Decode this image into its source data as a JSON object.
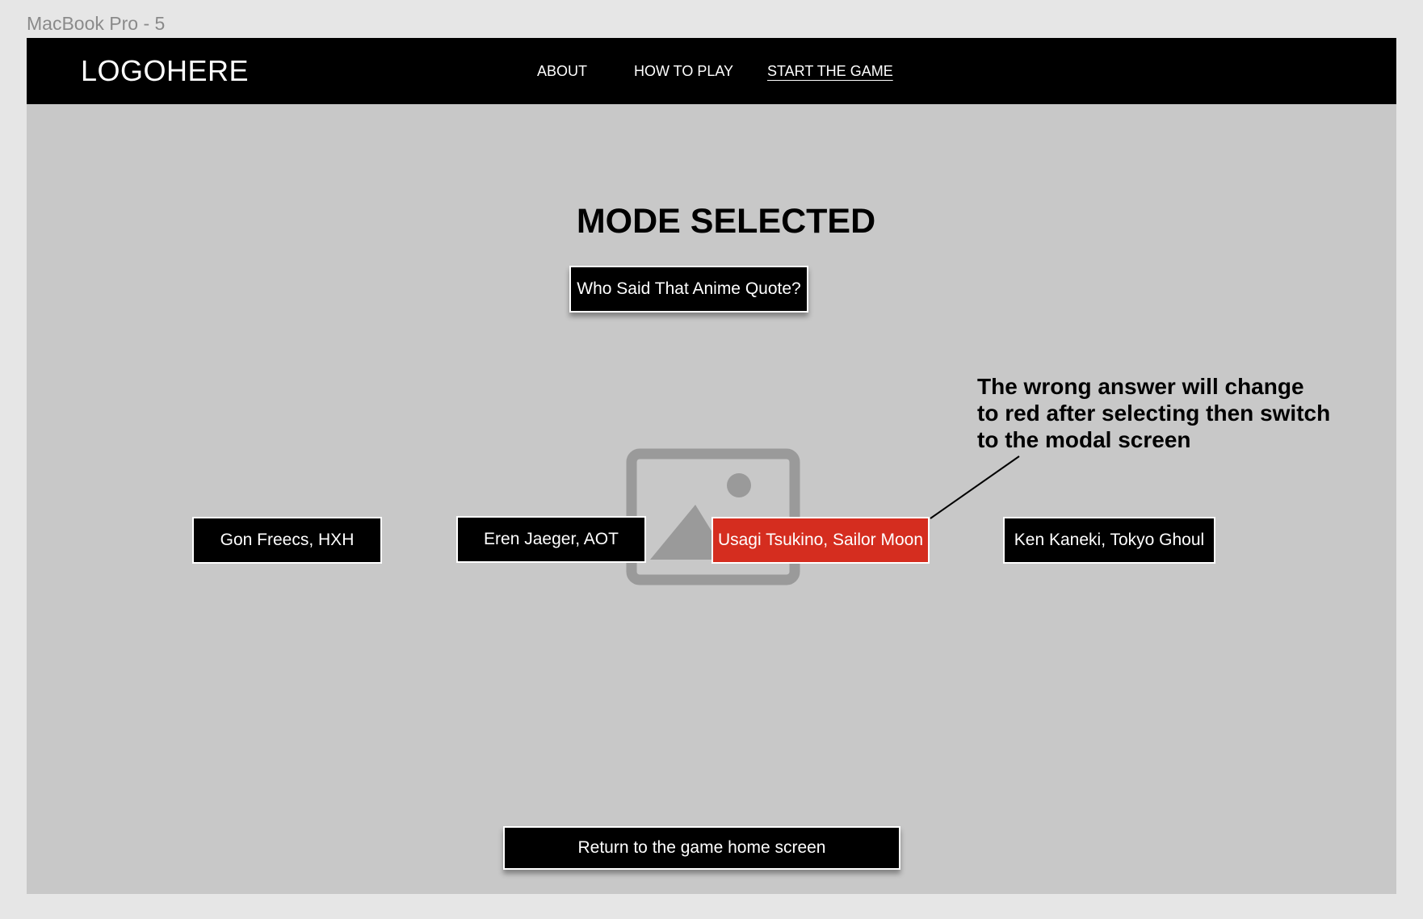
{
  "frame": {
    "label": "MacBook Pro - 5"
  },
  "navbar": {
    "logo": "LOGOHERE",
    "links": [
      {
        "label": "ABOUT"
      },
      {
        "label": "HOW TO PLAY"
      },
      {
        "label": "START THE GAME",
        "active": true
      }
    ]
  },
  "main": {
    "title": "MODE SELECTED",
    "mode_button": "Who Said That Anime Quote?",
    "image_placeholder_icon": "image-placeholder-icon",
    "answers": [
      {
        "label": "Gon Freecs, HXH",
        "state": "default"
      },
      {
        "label": "Eren Jaeger, AOT",
        "state": "default"
      },
      {
        "label": "Usagi Tsukino, Sailor Moon",
        "state": "wrong"
      },
      {
        "label": "Ken Kaneki, Tokyo Ghoul",
        "state": "default"
      }
    ],
    "annotation": {
      "lines": [
        "The wrong answer will change",
        "to red after selecting then switch",
        "to the modal screen"
      ]
    },
    "return_button": "Return to the game home screen"
  },
  "colors": {
    "navbar": "#000000",
    "canvas": "#c8c8c8",
    "outer": "#e6e6e6",
    "wrong_answer": "#d52d1f",
    "placeholder_icon": "#9a9a9a"
  }
}
